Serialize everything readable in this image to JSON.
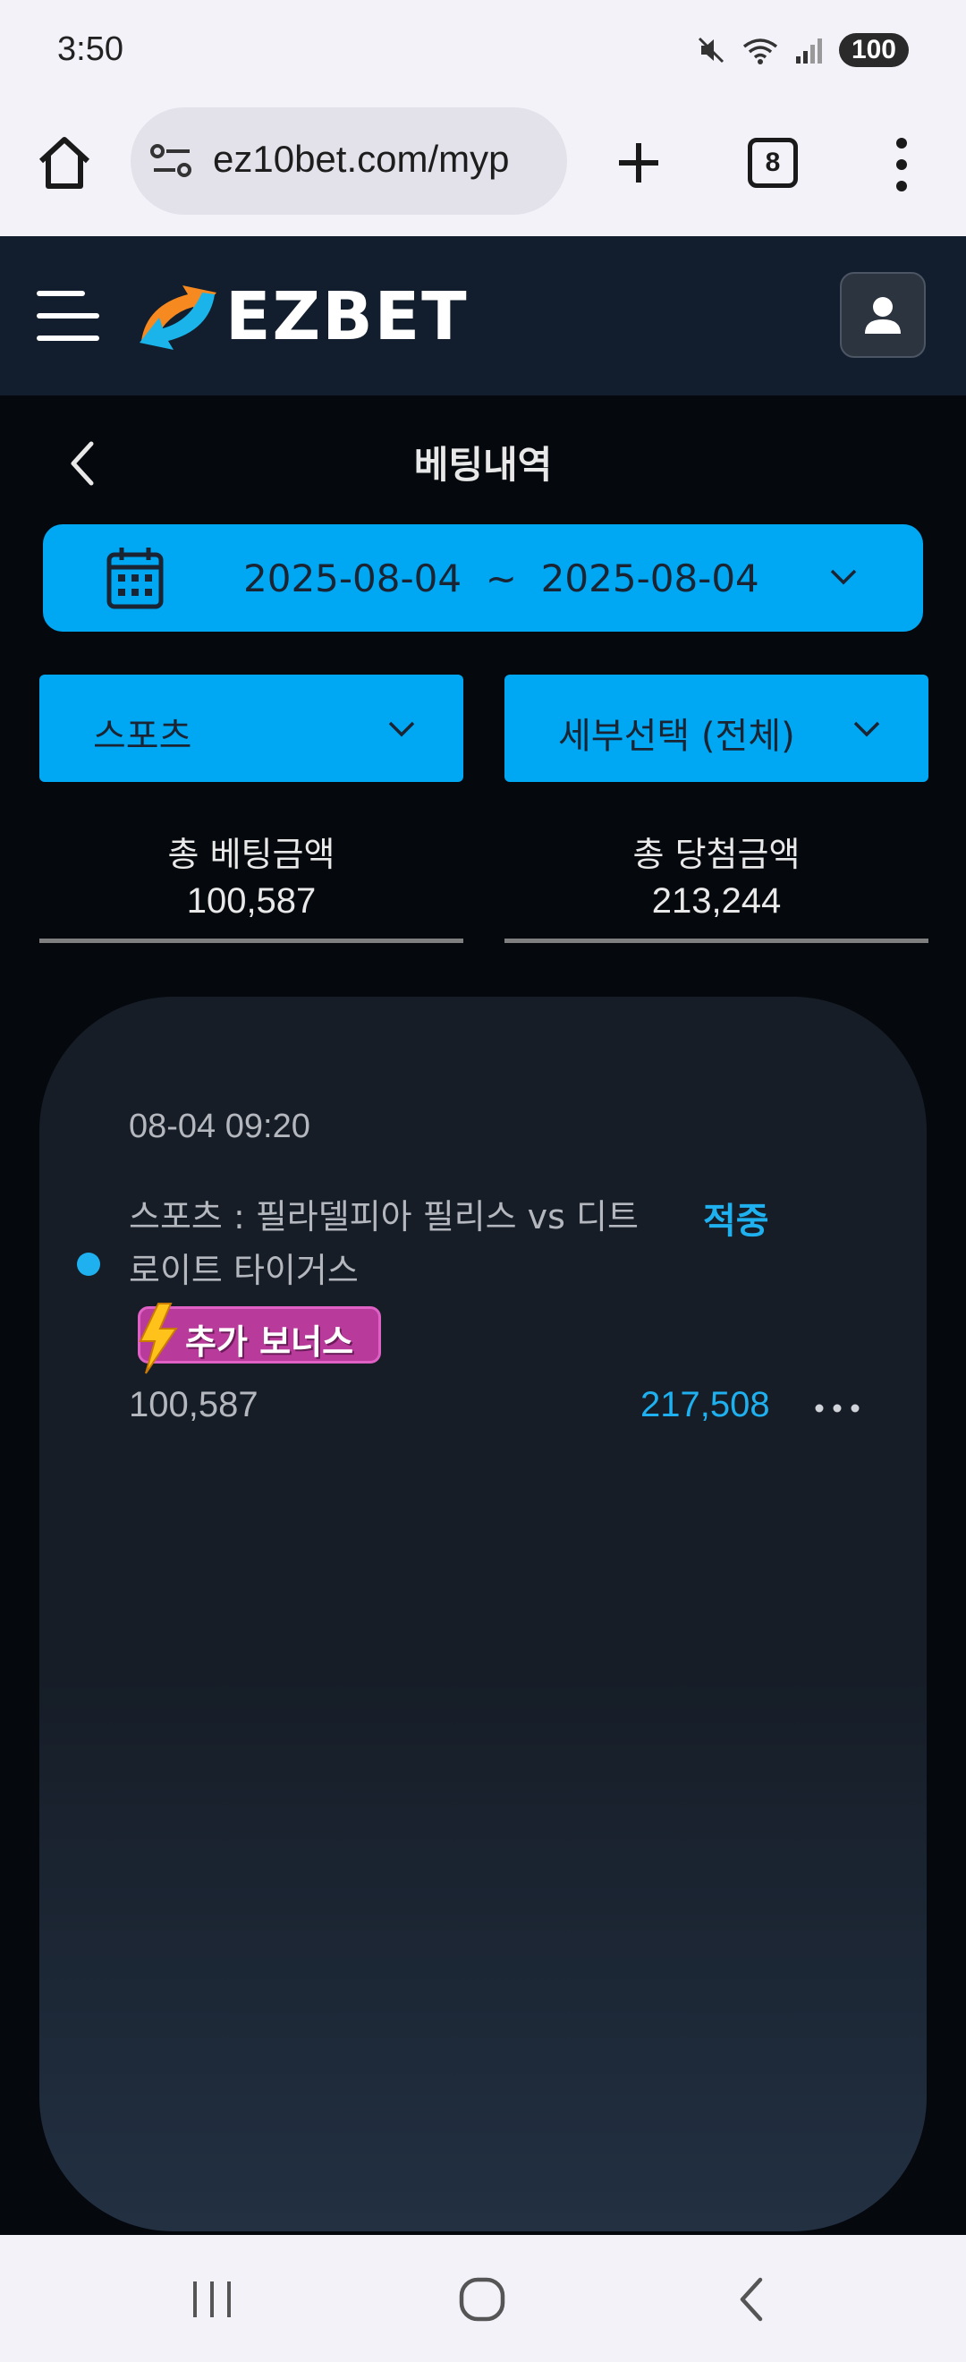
{
  "status_bar": {
    "time": "3:50",
    "battery": "100",
    "icons": [
      "mute-icon",
      "wifi-icon",
      "signal-icon"
    ]
  },
  "browser": {
    "url": "ez10bet.com/myp",
    "tab_count": "8"
  },
  "site": {
    "logo_text": "EZBET"
  },
  "page": {
    "title": "베팅내역",
    "date_range": "2025-08-04  ~  2025-08-04"
  },
  "filters": {
    "category": "스포츠",
    "detail": "세부선택 (전체)"
  },
  "totals": {
    "bet_label": "총 베팅금액",
    "bet_value": "100,587",
    "win_label": "총 당첨금액",
    "win_value": "213,244"
  },
  "bets": [
    {
      "datetime": "08-04 09:20",
      "match": "스포츠 : 필라델피아 필리스 vs 디트로이트 타이거스",
      "status": "적중",
      "bonus_badge": "추가 보너스",
      "amount": "100,587",
      "payout": "217,508"
    }
  ],
  "colors": {
    "accent": "#00a8f4",
    "header_bg": "#121e2d",
    "page_bg": "#05080d",
    "win_text": "#1fb1ef"
  }
}
